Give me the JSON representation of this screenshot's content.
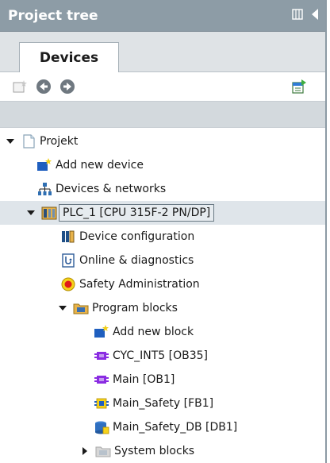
{
  "panel": {
    "title": "Project tree"
  },
  "tabs": [
    {
      "label": "Devices"
    }
  ],
  "tree": {
    "root": {
      "label": "Projekt"
    },
    "add_device": {
      "label": "Add new device"
    },
    "devices_networks": {
      "label": "Devices & networks"
    },
    "plc": {
      "label": "PLC_1 [CPU 315F-2 PN/DP]"
    },
    "device_config": {
      "label": "Device configuration"
    },
    "online_diag": {
      "label": "Online & diagnostics"
    },
    "safety_admin": {
      "label": "Safety Administration"
    },
    "program_blocks": {
      "label": "Program blocks"
    },
    "add_block": {
      "label": "Add new block"
    },
    "cyc_int5": {
      "label": "CYC_INT5 [OB35]"
    },
    "main": {
      "label": "Main [OB1]"
    },
    "main_safety": {
      "label": "Main_Safety [FB1]"
    },
    "main_safety_db": {
      "label": "Main_Safety_DB [DB1]"
    },
    "system_blocks": {
      "label": "System blocks"
    }
  },
  "icons": {
    "title_controls": [
      "layout-toggle-icon",
      "collapse-left-icon"
    ],
    "toolbar": [
      "new-item-icon",
      "back-icon",
      "forward-icon",
      "save-export-icon"
    ]
  },
  "colors": {
    "titlebar": "#8d9ca6",
    "selection": "#dfe5ea",
    "block_purple": "#8a2be2",
    "safety_yellow": "#f5d21a"
  }
}
